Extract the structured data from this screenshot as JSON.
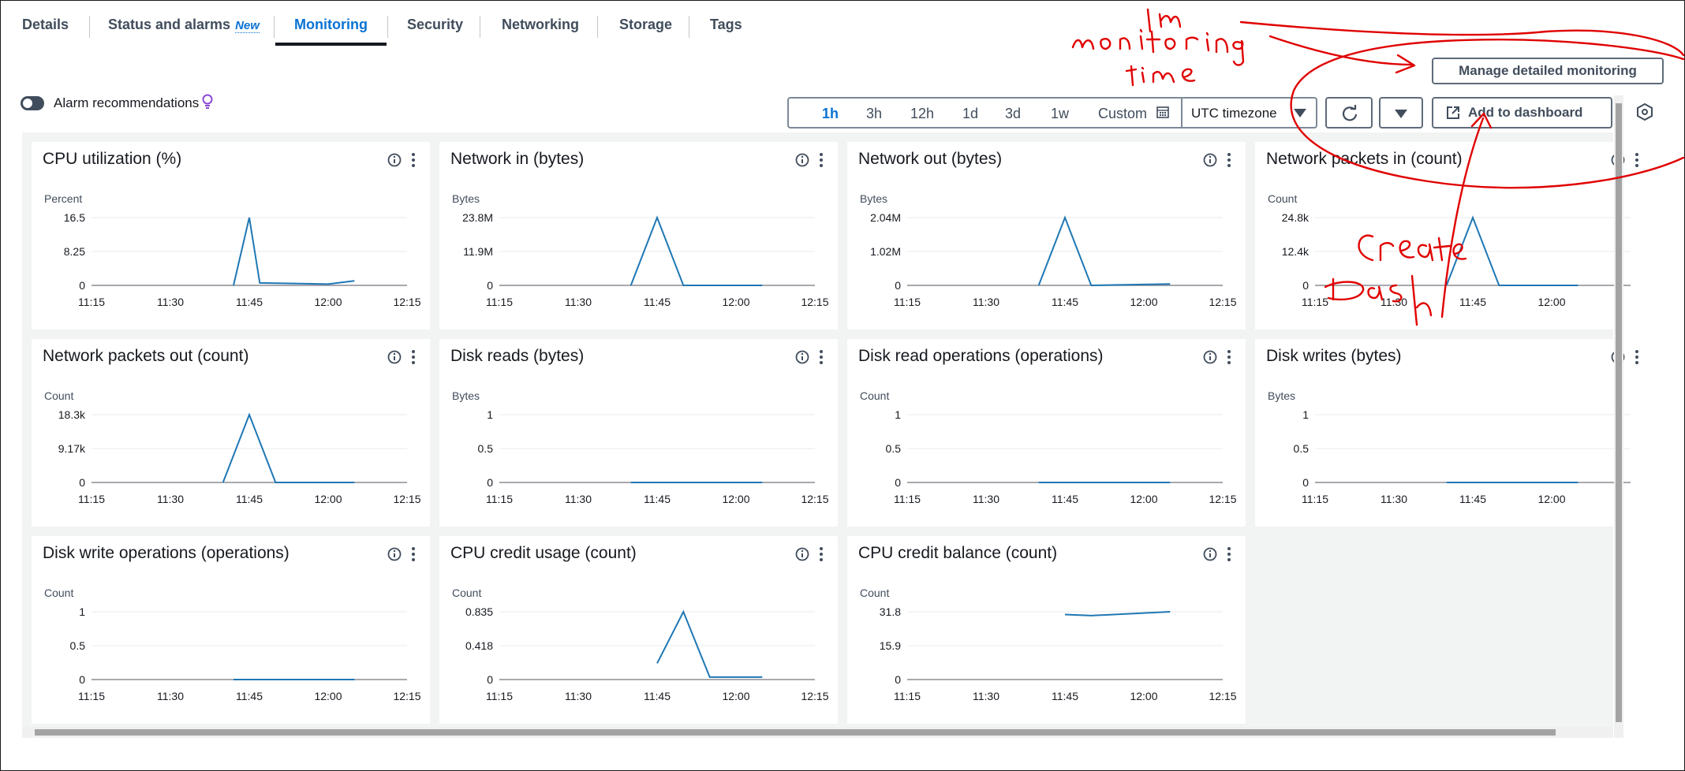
{
  "tabs": [
    {
      "label": "Details",
      "badge": ""
    },
    {
      "label": "Status and alarms",
      "badge": "New"
    },
    {
      "label": "Monitoring",
      "badge": ""
    },
    {
      "label": "Security",
      "badge": ""
    },
    {
      "label": "Networking",
      "badge": ""
    },
    {
      "label": "Storage",
      "badge": ""
    },
    {
      "label": "Tags",
      "badge": ""
    }
  ],
  "active_tab": "Monitoring",
  "alarm_toggle": {
    "label": "Alarm recommendations",
    "on": false
  },
  "manage_button": "Manage detailed monitoring",
  "time_range": {
    "options": [
      "1h",
      "3h",
      "12h",
      "1d",
      "3d",
      "1w"
    ],
    "selected": "1h",
    "custom_label": "Custom",
    "timezone": "UTC timezone"
  },
  "add_to_dashboard": "Add to dashboard",
  "annotations": [
    "Im monitoring time",
    "Create dash"
  ],
  "colors": {
    "accent": "#0972d3",
    "series": "#1f77b4",
    "annotation": "#e00000"
  },
  "chart_data": [
    {
      "type": "line",
      "title": "CPU utilization (%)",
      "ylabel": "Percent",
      "yticks": [
        "0",
        "8.25",
        "16.5"
      ],
      "ylim": [
        0,
        16.5
      ],
      "xticks": [
        "11:15",
        "11:30",
        "11:45",
        "12:00",
        "12:15"
      ],
      "series": [
        {
          "x": [
            "11:42",
            "11:45",
            "11:47",
            "12:00",
            "12:05"
          ],
          "y": [
            0,
            16.5,
            0.6,
            0.3,
            1.1
          ]
        }
      ]
    },
    {
      "type": "line",
      "title": "Network in (bytes)",
      "ylabel": "Bytes",
      "yticks": [
        "0",
        "11.9M",
        "23.8M"
      ],
      "ylim": [
        0,
        23.8
      ],
      "xticks": [
        "11:15",
        "11:30",
        "11:45",
        "12:00",
        "12:15"
      ],
      "series": [
        {
          "x": [
            "11:40",
            "11:45",
            "11:50",
            "12:05"
          ],
          "y": [
            0,
            23.8,
            0,
            0
          ]
        }
      ]
    },
    {
      "type": "line",
      "title": "Network out (bytes)",
      "ylabel": "Bytes",
      "yticks": [
        "0",
        "1.02M",
        "2.04M"
      ],
      "ylim": [
        0,
        2.04
      ],
      "xticks": [
        "11:15",
        "11:30",
        "11:45",
        "12:00",
        "12:15"
      ],
      "series": [
        {
          "x": [
            "11:40",
            "11:45",
            "11:50",
            "12:05"
          ],
          "y": [
            0,
            2.04,
            0,
            0.04
          ]
        }
      ]
    },
    {
      "type": "line",
      "title": "Network packets in (count)",
      "ylabel": "Count",
      "yticks": [
        "0",
        "12.4k",
        "24.8k"
      ],
      "ylim": [
        0,
        24.8
      ],
      "xticks": [
        "11:15",
        "11:30",
        "11:45",
        "12:00"
      ],
      "series": [
        {
          "x": [
            "11:40",
            "11:45",
            "11:50",
            "12:05"
          ],
          "y": [
            0,
            24.8,
            0,
            0
          ]
        }
      ]
    },
    {
      "type": "line",
      "title": "Network packets out (count)",
      "ylabel": "Count",
      "yticks": [
        "0",
        "9.17k",
        "18.3k"
      ],
      "ylim": [
        0,
        18.3
      ],
      "xticks": [
        "11:15",
        "11:30",
        "11:45",
        "12:00",
        "12:15"
      ],
      "series": [
        {
          "x": [
            "11:40",
            "11:45",
            "11:50",
            "12:05"
          ],
          "y": [
            0,
            18.3,
            0,
            0
          ]
        }
      ]
    },
    {
      "type": "line",
      "title": "Disk reads (bytes)",
      "ylabel": "Bytes",
      "yticks": [
        "0",
        "0.5",
        "1"
      ],
      "ylim": [
        0,
        1
      ],
      "xticks": [
        "11:15",
        "11:30",
        "11:45",
        "12:00",
        "12:15"
      ],
      "series": [
        {
          "x": [
            "11:40",
            "12:05"
          ],
          "y": [
            0,
            0
          ]
        }
      ]
    },
    {
      "type": "line",
      "title": "Disk read operations (operations)",
      "ylabel": "Count",
      "yticks": [
        "0",
        "0.5",
        "1"
      ],
      "ylim": [
        0,
        1
      ],
      "xticks": [
        "11:15",
        "11:30",
        "11:45",
        "12:00",
        "12:15"
      ],
      "series": [
        {
          "x": [
            "11:40",
            "12:05"
          ],
          "y": [
            0,
            0
          ]
        }
      ]
    },
    {
      "type": "line",
      "title": "Disk writes (bytes)",
      "ylabel": "Bytes",
      "yticks": [
        "0",
        "0.5",
        "1"
      ],
      "ylim": [
        0,
        1
      ],
      "xticks": [
        "11:15",
        "11:30",
        "11:45",
        "12:00"
      ],
      "series": [
        {
          "x": [
            "11:40",
            "12:05"
          ],
          "y": [
            0,
            0
          ]
        }
      ]
    },
    {
      "type": "line",
      "title": "Disk write operations (operations)",
      "ylabel": "Count",
      "yticks": [
        "0",
        "0.5",
        "1"
      ],
      "ylim": [
        0,
        1
      ],
      "xticks": [
        "11:15",
        "11:30",
        "11:45",
        "12:00",
        "12:15"
      ],
      "series": [
        {
          "x": [
            "11:42",
            "12:05"
          ],
          "y": [
            0,
            0
          ]
        }
      ]
    },
    {
      "type": "line",
      "title": "CPU credit usage (count)",
      "ylabel": "Count",
      "yticks": [
        "0",
        "0.418",
        "0.835"
      ],
      "ylim": [
        0,
        0.835
      ],
      "xticks": [
        "11:15",
        "11:30",
        "11:45",
        "12:00",
        "12:15"
      ],
      "series": [
        {
          "x": [
            "11:45",
            "11:50",
            "11:55",
            "12:05"
          ],
          "y": [
            0.2,
            0.835,
            0.03,
            0.03
          ]
        }
      ]
    },
    {
      "type": "line",
      "title": "CPU credit balance (count)",
      "ylabel": "Count",
      "yticks": [
        "0",
        "15.9",
        "31.8"
      ],
      "ylim": [
        0,
        31.8
      ],
      "xticks": [
        "11:15",
        "11:30",
        "11:45",
        "12:00",
        "12:15"
      ],
      "series": [
        {
          "x": [
            "11:45",
            "11:50",
            "12:05"
          ],
          "y": [
            30.5,
            30,
            31.8
          ]
        }
      ]
    }
  ]
}
